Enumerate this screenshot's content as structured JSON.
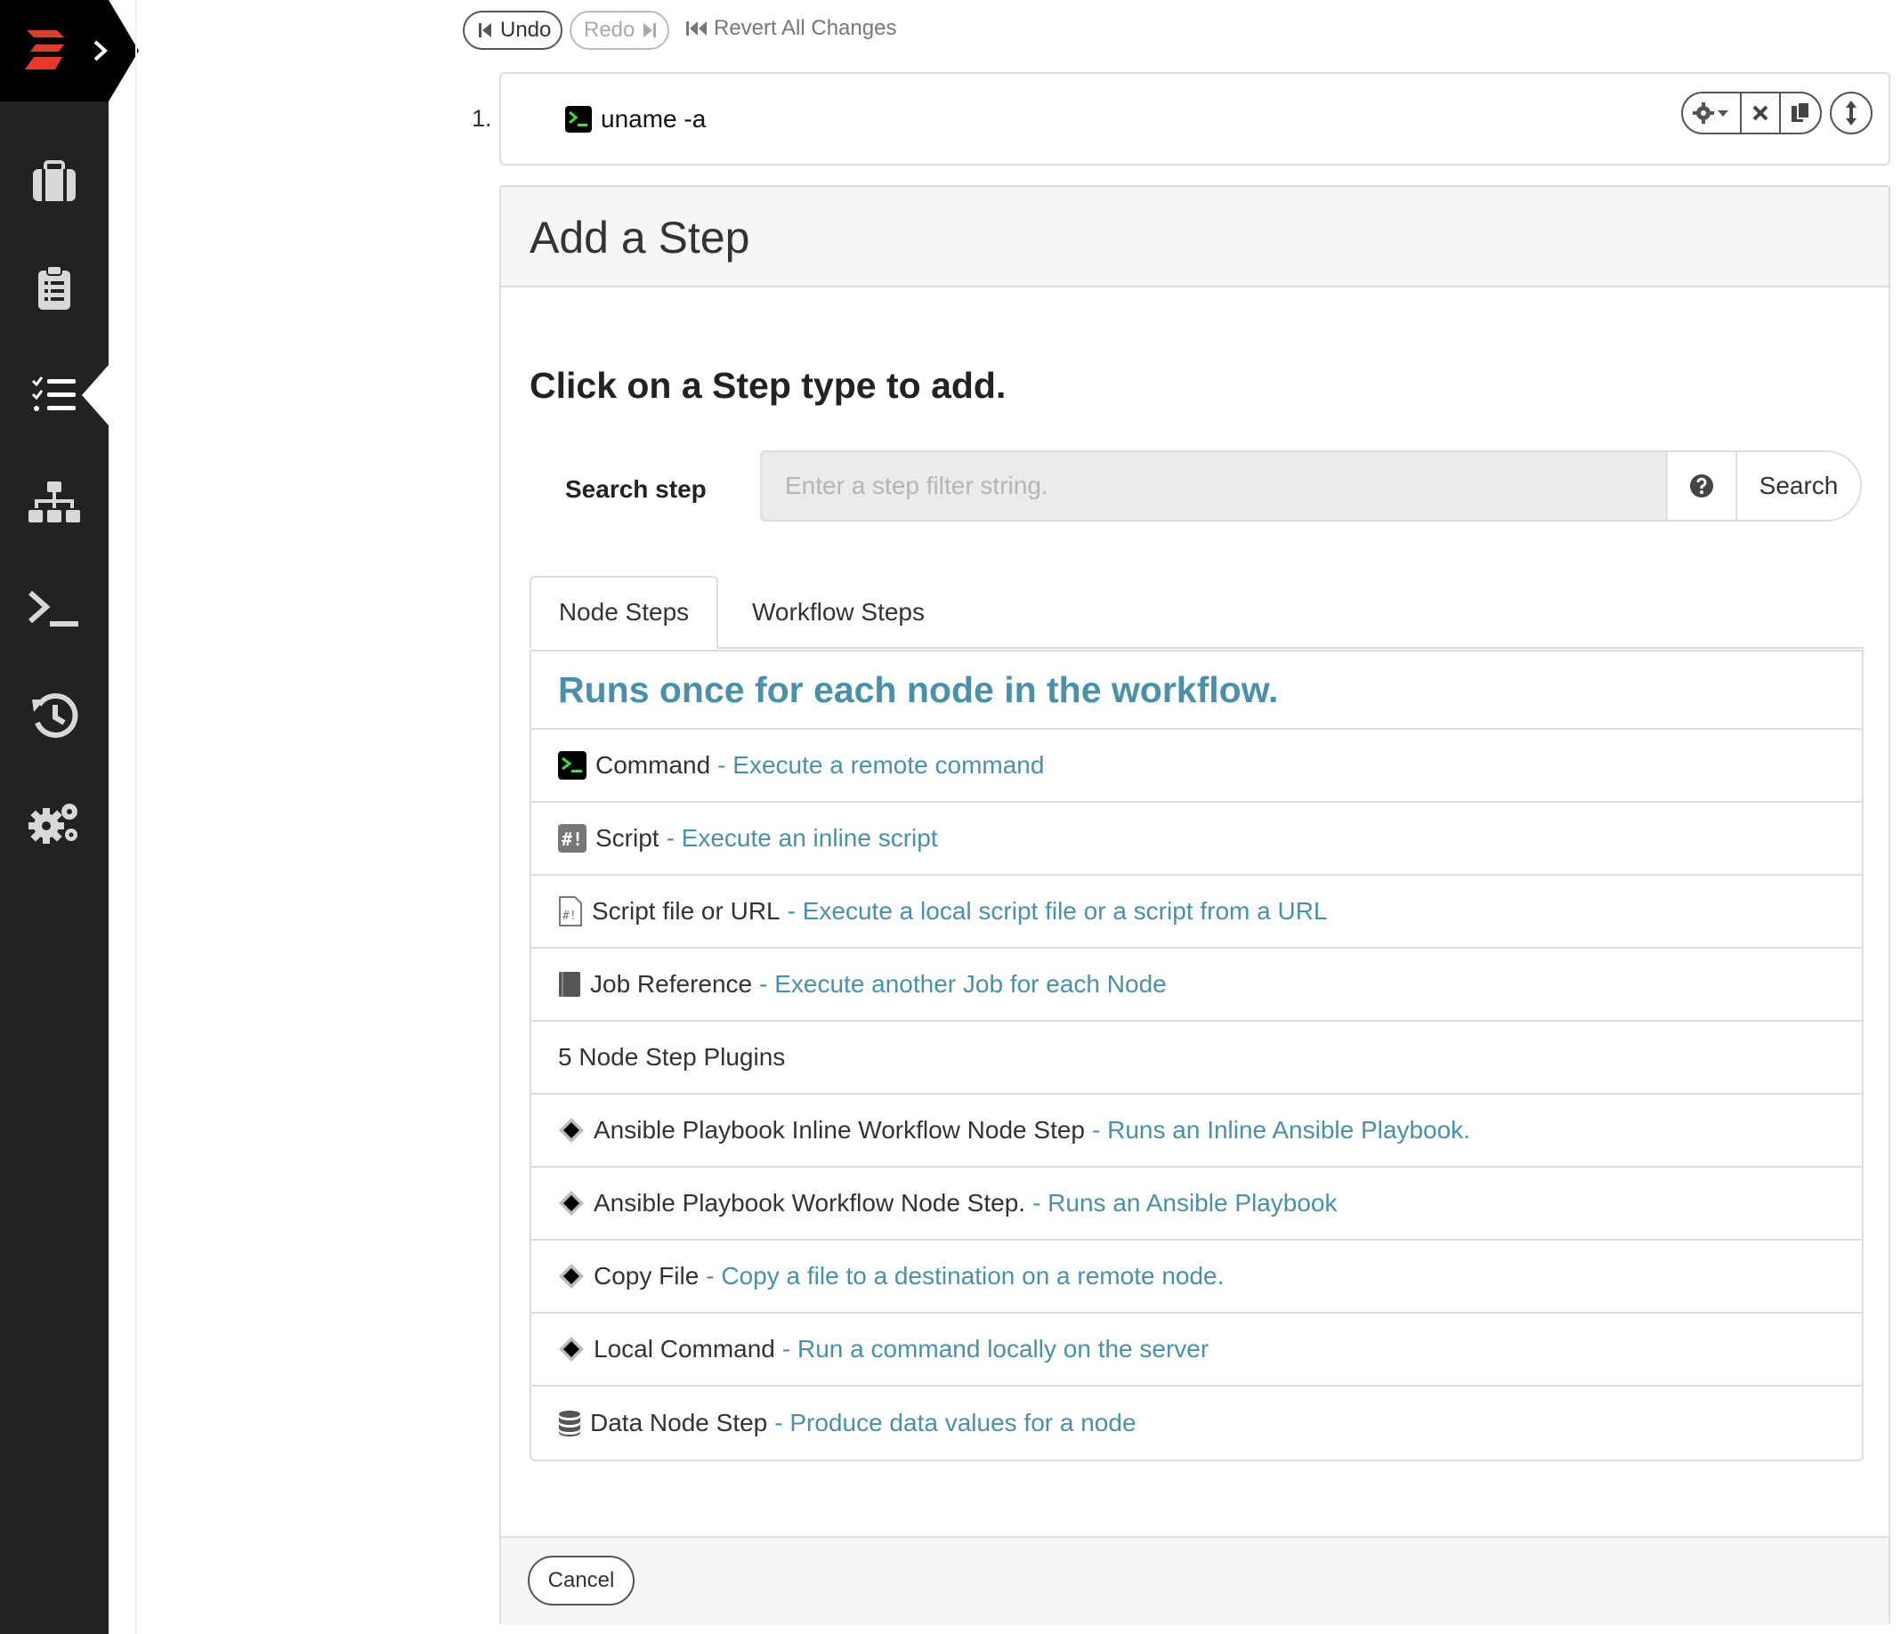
{
  "sidebar": {
    "items": [
      {
        "name": "jobs",
        "icon": "briefcase-icon"
      },
      {
        "name": "activity",
        "icon": "clipboard-icon"
      },
      {
        "name": "workflow",
        "icon": "task-list-icon",
        "active": true
      },
      {
        "name": "nodes",
        "icon": "sitemap-icon"
      },
      {
        "name": "commands",
        "icon": "terminal-icon"
      },
      {
        "name": "history",
        "icon": "history-icon"
      },
      {
        "name": "settings",
        "icon": "gears-icon"
      }
    ],
    "colors": {
      "background": "#222222",
      "logo_accent": "#e53b2c"
    }
  },
  "toolbar": {
    "undo_label": "Undo",
    "redo_label": "Redo",
    "revert_label": "Revert All Changes"
  },
  "step": {
    "number": "1.",
    "command": "uname -a",
    "actions": [
      "gear-dropdown-icon",
      "close-icon",
      "copy-icon",
      "reorder-icon"
    ]
  },
  "add_step": {
    "title": "Add a Step",
    "instruction": "Click on a Step type to add.",
    "search_label": "Search step",
    "search_placeholder": "Enter a step filter string.",
    "search_value": "",
    "search_button": "Search",
    "tabs": [
      {
        "label": "Node Steps",
        "active": true
      },
      {
        "label": "Workflow Steps",
        "active": false
      }
    ],
    "list_heading": "Runs once for each node in the workflow.",
    "items": [
      {
        "name": "Command",
        "desc": "- Execute a remote command",
        "icon": "terminal-icon"
      },
      {
        "name": "Script",
        "desc": "- Execute an inline script",
        "icon": "script-icon"
      },
      {
        "name": "Script file or URL",
        "desc": "- Execute a local script file or a script from a URL",
        "icon": "script-file-icon"
      },
      {
        "name": "Job Reference",
        "desc": "- Execute another Job for each Node",
        "icon": "book-icon"
      }
    ],
    "plugins_heading": "5 Node Step Plugins",
    "plugins": [
      {
        "name": "Ansible Playbook Inline Workflow Node Step",
        "desc": "- Runs an Inline Ansible Playbook.",
        "icon": "plugin-diamond-icon"
      },
      {
        "name": "Ansible Playbook Workflow Node Step.",
        "desc": "- Runs an Ansible Playbook",
        "icon": "plugin-diamond-icon"
      },
      {
        "name": "Copy File",
        "desc": "- Copy a file to a destination on a remote node.",
        "icon": "plugin-diamond-icon"
      },
      {
        "name": "Local Command",
        "desc": "- Run a command locally on the server",
        "icon": "plugin-diamond-icon"
      },
      {
        "name": "Data Node Step",
        "desc": "- Produce data values for a node",
        "icon": "database-icon"
      }
    ],
    "cancel_label": "Cancel",
    "accent_color": "#4a90a8"
  }
}
